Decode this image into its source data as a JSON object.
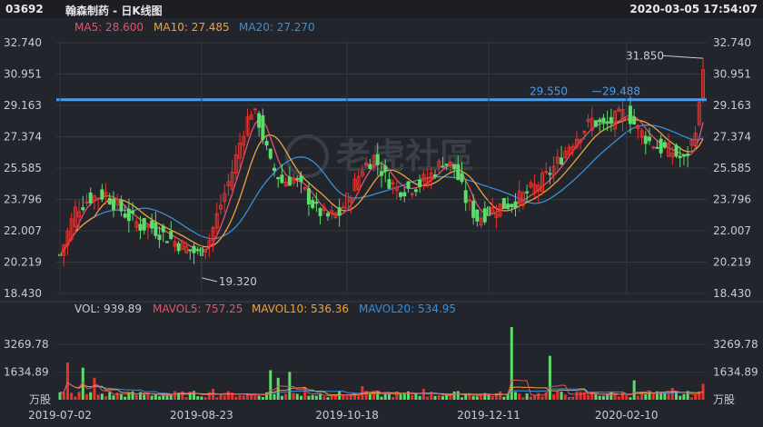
{
  "header": {
    "code": "03692",
    "title": "翰森制药 - 日K线图",
    "datetime": "2020-03-05 17:54:07"
  },
  "legend": {
    "ma5": {
      "label": "MA5: 28.600",
      "color": "#e2556c"
    },
    "ma10": {
      "label": "MA10: 27.485",
      "color": "#f0a23a"
    },
    "ma20": {
      "label": "MA20: 27.270",
      "color": "#3a8fd6"
    }
  },
  "vol_legend": {
    "vol": {
      "label": "VOL: 939.89",
      "color": "#c9ccd2"
    },
    "mavol5": {
      "label": "MAVOL5: 757.25",
      "color": "#e2556c"
    },
    "mavol10": {
      "label": "MAVOL10: 536.36",
      "color": "#f0a23a"
    },
    "mavol20": {
      "label": "MAVOL20: 534.95",
      "color": "#3a8fd6"
    }
  },
  "watermark": "老虎社區",
  "colors": {
    "up": "#e8322e",
    "down": "#5ddc6a",
    "resistance": "#4a9cf0",
    "grid": "#34383f"
  },
  "chart_data": {
    "type": "candlestick",
    "y_ticks": [
      "32.740",
      "30.951",
      "29.163",
      "27.374",
      "25.585",
      "23.796",
      "22.007",
      "20.219",
      "18.430"
    ],
    "ylim": [
      18.43,
      32.74
    ],
    "x_ticks": [
      {
        "label": "2019-07-02",
        "index": 0
      },
      {
        "label": "2019-08-23",
        "index": 37
      },
      {
        "label": "2019-10-18",
        "index": 75
      },
      {
        "label": "2019-12-11",
        "index": 112
      },
      {
        "label": "2020-02-10",
        "index": 148
      }
    ],
    "price": {
      "anchors": [
        [
          0,
          20.6
        ],
        [
          4,
          23.2
        ],
        [
          8,
          23.9
        ],
        [
          12,
          24.1
        ],
        [
          15,
          23.4
        ],
        [
          18,
          22.8
        ],
        [
          21,
          22.3
        ],
        [
          24,
          22.2
        ],
        [
          27,
          21.8
        ],
        [
          30,
          21.4
        ],
        [
          33,
          21.0
        ],
        [
          36,
          20.7
        ],
        [
          39,
          21.5
        ],
        [
          42,
          23.5
        ],
        [
          45,
          25.4
        ],
        [
          48,
          27.8
        ],
        [
          50,
          28.9
        ],
        [
          52,
          28.2
        ],
        [
          55,
          25.8
        ],
        [
          58,
          24.8
        ],
        [
          61,
          25.0
        ],
        [
          64,
          24.2
        ],
        [
          67,
          23.2
        ],
        [
          70,
          22.8
        ],
        [
          73,
          23.0
        ],
        [
          76,
          24.2
        ],
        [
          79,
          25.6
        ],
        [
          82,
          26.2
        ],
        [
          85,
          25.1
        ],
        [
          88,
          24.4
        ],
        [
          91,
          24.4
        ],
        [
          94,
          24.7
        ],
        [
          97,
          25.2
        ],
        [
          100,
          26.0
        ],
        [
          103,
          25.6
        ],
        [
          106,
          23.8
        ],
        [
          109,
          22.7
        ],
        [
          112,
          23.1
        ],
        [
          115,
          23.4
        ],
        [
          118,
          23.6
        ],
        [
          121,
          24.0
        ],
        [
          124,
          24.5
        ],
        [
          127,
          25.1
        ],
        [
          130,
          25.9
        ],
        [
          133,
          26.9
        ],
        [
          136,
          27.6
        ],
        [
          139,
          28.3
        ],
        [
          142,
          28.0
        ],
        [
          145,
          28.4
        ],
        [
          148,
          28.8
        ],
        [
          151,
          27.8
        ],
        [
          154,
          27.1
        ],
        [
          157,
          26.7
        ],
        [
          160,
          26.5
        ],
        [
          163,
          26.0
        ],
        [
          165,
          27.0
        ],
        [
          167,
          29.0
        ],
        [
          168,
          30.5
        ]
      ],
      "high_label": "19.320",
      "low_label_index": 37,
      "peak_label": "31.850",
      "peak_index": 168,
      "resistance": {
        "value": 29.488,
        "label_a": "29.550",
        "label_b": "29.488"
      }
    },
    "volume": {
      "y_ticks": [
        "3269.78",
        "1634.89",
        "万股"
      ],
      "ylim": [
        0,
        4300
      ],
      "spikes": [
        [
          2,
          2200
        ],
        [
          6,
          1900
        ],
        [
          9,
          1300
        ],
        [
          40,
          650
        ],
        [
          55,
          1750
        ],
        [
          57,
          1300
        ],
        [
          60,
          1650
        ],
        [
          64,
          700
        ],
        [
          79,
          800
        ],
        [
          95,
          650
        ],
        [
          118,
          4300
        ],
        [
          128,
          2600
        ],
        [
          150,
          1150
        ],
        [
          160,
          700
        ],
        [
          168,
          940
        ]
      ],
      "base": 350
    }
  }
}
